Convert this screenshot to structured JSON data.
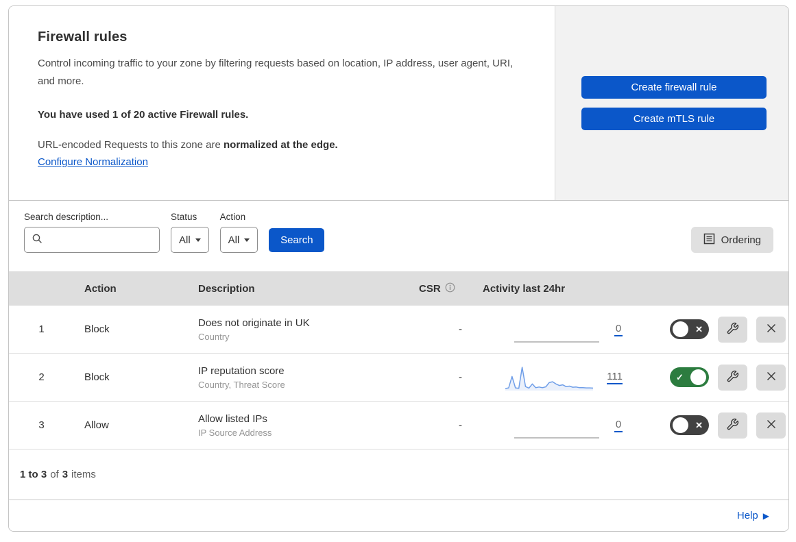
{
  "colors": {
    "accent_blue": "#0b57c9",
    "toggle_on_green": "#2c7c3f",
    "toggle_off_gray": "#414141",
    "panel_bg": "#f2f2f2",
    "table_header_bg": "#dedede",
    "sparkline_blue": "#6f9ee8"
  },
  "header": {
    "title": "Firewall rules",
    "description": "Control incoming traffic to your zone by filtering requests based on location, IP address, user agent, URI, and more.",
    "usage_text": "You have used 1 of 20 active Firewall rules.",
    "normalization_prefix": "URL-encoded Requests to this zone are ",
    "normalization_bold": "normalized at the edge.",
    "normalization_link": "Configure Normalization",
    "create_firewall_button": "Create firewall rule",
    "create_mtls_button": "Create mTLS rule"
  },
  "filters": {
    "search_label": "Search description...",
    "search_placeholder": "",
    "status_label": "Status",
    "status_value": "All",
    "action_label": "Action",
    "action_value": "All",
    "search_button": "Search",
    "ordering_button": "Ordering"
  },
  "table": {
    "columns": {
      "action": "Action",
      "description": "Description",
      "csr": "CSR",
      "activity": "Activity last 24hr"
    },
    "rows": [
      {
        "index": "1",
        "action": "Block",
        "description": "Does not originate in UK",
        "criteria": "Country",
        "csr": "-",
        "activity_count": "0",
        "enabled": false,
        "sparkline": []
      },
      {
        "index": "2",
        "action": "Block",
        "description": "IP reputation score",
        "criteria": "Country, Threat Score",
        "csr": "-",
        "activity_count": "111",
        "enabled": true,
        "sparkline": [
          3,
          6,
          58,
          6,
          4,
          100,
          12,
          5,
          24,
          7,
          10,
          7,
          11,
          30,
          34,
          24,
          17,
          20,
          12,
          14,
          9,
          10,
          7,
          7,
          6,
          6,
          5
        ]
      },
      {
        "index": "3",
        "action": "Allow",
        "description": "Allow listed IPs",
        "criteria": "IP Source Address",
        "csr": "-",
        "activity_count": "0",
        "enabled": false,
        "sparkline": []
      }
    ]
  },
  "toggle": {
    "on_symbol": "✓",
    "off_symbol": "✕"
  },
  "footer": {
    "range": "1 to 3",
    "of_word": "of",
    "total": "3",
    "items_word": "items",
    "help": "Help",
    "help_arrow": "▶"
  }
}
